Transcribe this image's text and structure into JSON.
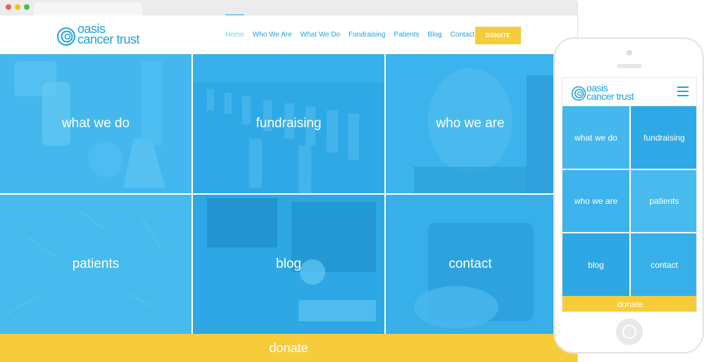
{
  "colors": {
    "brand_blue": "#1fa3df",
    "tile_blue": "#3db7ef",
    "tile_blue_alt": "#30aee8",
    "donate_yellow": "#f7cc3a"
  },
  "brand": {
    "line1": "oasis",
    "line2": "cancer trust",
    "logo_icon": "swirl-circle-icon"
  },
  "nav": {
    "items": [
      {
        "label": "Home",
        "active": true
      },
      {
        "label": "Who We Are"
      },
      {
        "label": "What We Do"
      },
      {
        "label": "Fundraising"
      },
      {
        "label": "Patients"
      },
      {
        "label": "Blog"
      },
      {
        "label": "Contact"
      }
    ],
    "donate_button": "DONATE"
  },
  "tiles": [
    {
      "label": "what we do"
    },
    {
      "label": "fundraising"
    },
    {
      "label": "who we are"
    },
    {
      "label": "patients"
    },
    {
      "label": "blog"
    },
    {
      "label": "contact"
    }
  ],
  "donate_bar": "donate",
  "mobile": {
    "menu_icon": "hamburger-menu-icon",
    "tiles": [
      {
        "label": "what we do"
      },
      {
        "label": "fundraising"
      },
      {
        "label": "who we are"
      },
      {
        "label": "patients"
      },
      {
        "label": "blog"
      },
      {
        "label": "contact"
      }
    ],
    "donate_bar": "donate"
  }
}
